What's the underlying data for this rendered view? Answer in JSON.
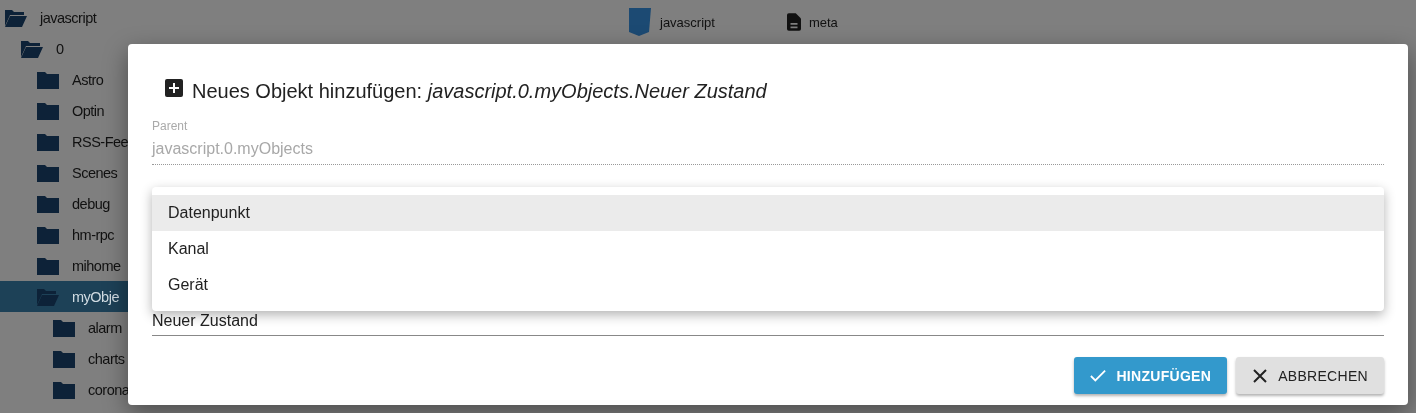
{
  "tree": [
    {
      "label": "javascript",
      "expanded": true,
      "selected": false,
      "children": [
        {
          "label": "0",
          "expanded": true,
          "selected": false,
          "children": [
            {
              "label": "Astro",
              "expanded": false,
              "selected": false
            },
            {
              "label": "Optin",
              "expanded": false,
              "selected": false
            },
            {
              "label": "RSS-Fee",
              "expanded": false,
              "selected": false
            },
            {
              "label": "Scenes",
              "expanded": false,
              "selected": false
            },
            {
              "label": "debug",
              "expanded": false,
              "selected": false
            },
            {
              "label": "hm-rpc",
              "expanded": false,
              "selected": false
            },
            {
              "label": "mihome",
              "expanded": false,
              "selected": false
            },
            {
              "label": "myObje",
              "expanded": true,
              "selected": true,
              "children": [
                {
                  "label": "alarm",
                  "expanded": false,
                  "selected": false
                },
                {
                  "label": "charts",
                  "expanded": false,
                  "selected": false
                },
                {
                  "label": "corona",
                  "expanded": false,
                  "selected": false
                }
              ]
            }
          ]
        }
      ]
    }
  ],
  "row_details": [
    {
      "kind": "js",
      "text": "javascript"
    },
    {
      "kind": "file",
      "text": "meta"
    }
  ],
  "dialog": {
    "title": "Neues Objekt hinzufügen: *javascript.0.myObjects.Neuer Zustand*",
    "parent": {
      "label": "Parent",
      "value": "javascript.0.myObjects",
      "disabled": true
    },
    "type_menu": [
      {
        "label": "Datenpunkt",
        "selected": true
      },
      {
        "label": "Kanal",
        "selected": false
      },
      {
        "label": "Gerät",
        "selected": false
      }
    ],
    "name": {
      "value": "Neuer Zustand"
    },
    "buttons": [
      {
        "kind": "confirm",
        "label": "HINZUFÜGEN"
      },
      {
        "kind": "cancel",
        "label": "ABBRECHEN"
      }
    ]
  }
}
